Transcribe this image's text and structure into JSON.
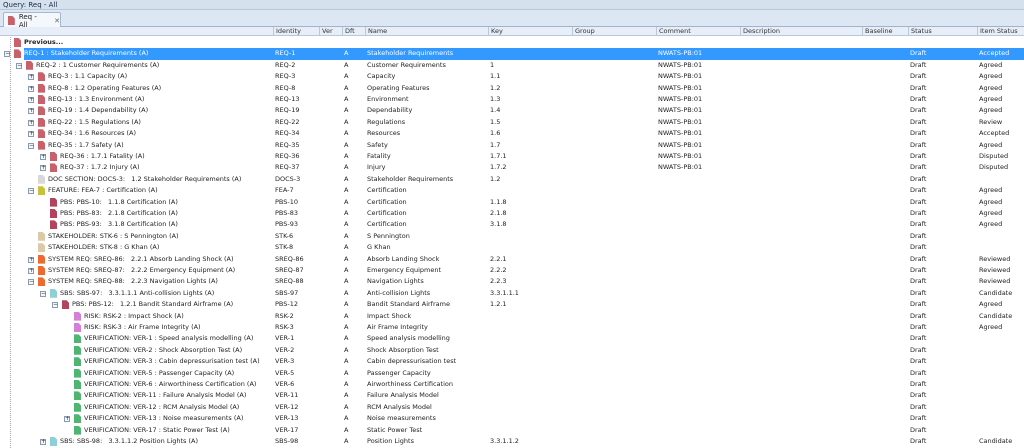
{
  "window": {
    "title": "Query: Req - All"
  },
  "tab": {
    "label": "Req - All",
    "close": "✕"
  },
  "columns": [
    "Identity",
    "Ver",
    "Dft",
    "Name",
    "Key",
    "Group",
    "Comment",
    "Description",
    "Baseline",
    "Status",
    "Item Status"
  ],
  "icon_colors": {
    "req": "#c9616a",
    "doc": "#d8d8d8",
    "fea": "#c8c23a",
    "pbs": "#b2445e",
    "stk": "#dcc9a6",
    "sreq": "#ee6a2e",
    "sbs": "#8fd0d8",
    "risk": "#d57fd6",
    "ver": "#4fb672"
  },
  "accent": "#3399ff",
  "rows": [
    {
      "label": "Previous...",
      "level": 0,
      "icon": "req",
      "exp": "",
      "identity": "",
      "ver": "",
      "dft": "",
      "name": "",
      "key": "",
      "comment": "",
      "status": "",
      "item_status": ""
    },
    {
      "label": "REQ-1 : Stakeholder Requirements (A)",
      "level": 0,
      "icon": "req",
      "exp": "-",
      "identity": "REQ-1",
      "ver": "",
      "dft": "A",
      "name": "Stakeholder Requirements",
      "key": "",
      "comment": "NWATS-PB:01",
      "status": "Draft",
      "item_status": "Accepted",
      "selected": true
    },
    {
      "label": "REQ-2 : 1 Customer Requirements (A)",
      "level": 1,
      "icon": "req",
      "exp": "-",
      "identity": "REQ-2",
      "ver": "",
      "dft": "A",
      "name": "Customer Requirements",
      "key": "1",
      "comment": "NWATS-PB:01",
      "status": "Draft",
      "item_status": "Agreed"
    },
    {
      "label": "REQ-3 : 1.1 Capacity (A)",
      "level": 2,
      "icon": "req",
      "exp": "+",
      "identity": "REQ-3",
      "ver": "",
      "dft": "A",
      "name": "Capacity",
      "key": "1.1",
      "comment": "NWATS-PB:01",
      "status": "Draft",
      "item_status": "Agreed"
    },
    {
      "label": "REQ-8 : 1.2 Operating Features (A)",
      "level": 2,
      "icon": "req",
      "exp": "+",
      "identity": "REQ-8",
      "ver": "",
      "dft": "A",
      "name": "Operating Features",
      "key": "1.2",
      "comment": "NWATS-PB:01",
      "status": "Draft",
      "item_status": "Agreed"
    },
    {
      "label": "REQ-13 : 1.3 Environment (A)",
      "level": 2,
      "icon": "req",
      "exp": "+",
      "identity": "REQ-13",
      "ver": "",
      "dft": "A",
      "name": "Environment",
      "key": "1.3",
      "comment": "NWATS-PB:01",
      "status": "Draft",
      "item_status": "Agreed"
    },
    {
      "label": "REQ-19 : 1.4 Dependability (A)",
      "level": 2,
      "icon": "req",
      "exp": "+",
      "identity": "REQ-19",
      "ver": "",
      "dft": "A",
      "name": "Dependability",
      "key": "1.4",
      "comment": "NWATS-PB:01",
      "status": "Draft",
      "item_status": "Agreed"
    },
    {
      "label": "REQ-22 : 1.5 Regulations (A)",
      "level": 2,
      "icon": "req",
      "exp": "+",
      "identity": "REQ-22",
      "ver": "",
      "dft": "A",
      "name": "Regulations",
      "key": "1.5",
      "comment": "NWATS-PB:01",
      "status": "Draft",
      "item_status": "Review"
    },
    {
      "label": "REQ-34 : 1.6 Resources (A)",
      "level": 2,
      "icon": "req",
      "exp": "+",
      "identity": "REQ-34",
      "ver": "",
      "dft": "A",
      "name": "Resources",
      "key": "1.6",
      "comment": "NWATS-PB:01",
      "status": "Draft",
      "item_status": "Accepted"
    },
    {
      "label": "REQ-35 : 1.7 Safety (A)",
      "level": 2,
      "icon": "req",
      "exp": "-",
      "identity": "REQ-35",
      "ver": "",
      "dft": "A",
      "name": "Safety",
      "key": "1.7",
      "comment": "NWATS-PB:01",
      "status": "Draft",
      "item_status": "Agreed"
    },
    {
      "label": "REQ-36 : 1.7.1 Fatality (A)",
      "level": 3,
      "icon": "req",
      "exp": "+",
      "identity": "REQ-36",
      "ver": "",
      "dft": "A",
      "name": "Fatality",
      "key": "1.7.1",
      "comment": "NWATS-PB:01",
      "status": "Draft",
      "item_status": "Disputed"
    },
    {
      "label": "REQ-37 : 1.7.2 Injury (A)",
      "level": 3,
      "icon": "req",
      "exp": "+",
      "identity": "REQ-37",
      "ver": "",
      "dft": "A",
      "name": "Injury",
      "key": "1.7.2",
      "comment": "NWATS-PB:01",
      "status": "Draft",
      "item_status": "Disputed"
    },
    {
      "label": "DOC SECTION: DOCS-3:   1.2 Stakeholder Requirements (A)",
      "level": 2,
      "icon": "doc",
      "exp": "",
      "identity": "DOCS-3",
      "ver": "",
      "dft": "A",
      "name": "Stakeholder Requirements",
      "key": "1.2",
      "comment": "",
      "status": "Draft",
      "item_status": ""
    },
    {
      "label": "FEATURE: FEA-7 : Certification (A)",
      "level": 2,
      "icon": "fea",
      "exp": "-",
      "identity": "FEA-7",
      "ver": "",
      "dft": "A",
      "name": "Certification",
      "key": "",
      "comment": "",
      "status": "Draft",
      "item_status": "Agreed"
    },
    {
      "label": "PBS: PBS-10:   1.1.8 Certification (A)",
      "level": 3,
      "icon": "pbs",
      "exp": "",
      "identity": "PBS-10",
      "ver": "",
      "dft": "A",
      "name": "Certification",
      "key": "1.1.8",
      "comment": "",
      "status": "Draft",
      "item_status": "Agreed"
    },
    {
      "label": "PBS: PBS-83:   2.1.8 Certification (A)",
      "level": 3,
      "icon": "pbs",
      "exp": "",
      "identity": "PBS-83",
      "ver": "",
      "dft": "A",
      "name": "Certification",
      "key": "2.1.8",
      "comment": "",
      "status": "Draft",
      "item_status": "Agreed"
    },
    {
      "label": "PBS: PBS-93:   3.1.8 Certification (A)",
      "level": 3,
      "icon": "pbs",
      "exp": "",
      "identity": "PBS-93",
      "ver": "",
      "dft": "A",
      "name": "Certification",
      "key": "3.1.8",
      "comment": "",
      "status": "Draft",
      "item_status": "Agreed"
    },
    {
      "label": "STAKEHOLDER: STK-6 : S Pennington (A)",
      "level": 2,
      "icon": "stk",
      "exp": "",
      "identity": "STK-6",
      "ver": "",
      "dft": "A",
      "name": "S Pennington",
      "key": "",
      "comment": "",
      "status": "Draft",
      "item_status": ""
    },
    {
      "label": "STAKEHOLDER: STK-8 : G Khan (A)",
      "level": 2,
      "icon": "stk",
      "exp": "",
      "identity": "STK-8",
      "ver": "",
      "dft": "A",
      "name": "G Khan",
      "key": "",
      "comment": "",
      "status": "Draft",
      "item_status": ""
    },
    {
      "label": "SYSTEM REQ: SREQ-86:   2.2.1 Absorb Landing Shock (A)",
      "level": 2,
      "icon": "sreq",
      "exp": "+",
      "identity": "SREQ-86",
      "ver": "",
      "dft": "A",
      "name": "Absorb Landing Shock",
      "key": "2.2.1",
      "comment": "",
      "status": "Draft",
      "item_status": "Reviewed"
    },
    {
      "label": "SYSTEM REQ: SREQ-87:   2.2.2 Emergency Equipment (A)",
      "level": 2,
      "icon": "sreq",
      "exp": "+",
      "identity": "SREQ-87",
      "ver": "",
      "dft": "A",
      "name": "Emergency Equipment",
      "key": "2.2.2",
      "comment": "",
      "status": "Draft",
      "item_status": "Reviewed"
    },
    {
      "label": "SYSTEM REQ: SREQ-88:   2.2.3 Navigation Lights (A)",
      "level": 2,
      "icon": "sreq",
      "exp": "-",
      "identity": "SREQ-88",
      "ver": "",
      "dft": "A",
      "name": "Navigation Lights",
      "key": "2.2.3",
      "comment": "",
      "status": "Draft",
      "item_status": "Reviewed"
    },
    {
      "label": "SBS: SBS-97:   3.3.1.1.1 Anti-collision Lights (A)",
      "level": 3,
      "icon": "sbs",
      "exp": "-",
      "identity": "SBS-97",
      "ver": "",
      "dft": "A",
      "name": "Anti-collision Lights",
      "key": "3.3.1.1.1",
      "comment": "",
      "status": "Draft",
      "item_status": "Candidate"
    },
    {
      "label": "PBS: PBS-12:   1.2.1 Bandit Standard Airframe (A)",
      "level": 4,
      "icon": "pbs",
      "exp": "-",
      "identity": "PBS-12",
      "ver": "",
      "dft": "A",
      "name": "Bandit Standard Airframe",
      "key": "1.2.1",
      "comment": "",
      "status": "Draft",
      "item_status": "Agreed"
    },
    {
      "label": "RISK: RSK-2 : Impact Shock (A)",
      "level": 5,
      "icon": "risk",
      "exp": "",
      "identity": "RSK-2",
      "ver": "",
      "dft": "A",
      "name": "Impact Shock",
      "key": "",
      "comment": "",
      "status": "Draft",
      "item_status": "Candidate"
    },
    {
      "label": "RISK: RSK-3 : Air Frame Integrity (A)",
      "level": 5,
      "icon": "risk",
      "exp": "",
      "identity": "RSK-3",
      "ver": "",
      "dft": "A",
      "name": "Air Frame Integrity",
      "key": "",
      "comment": "",
      "status": "Draft",
      "item_status": "Agreed"
    },
    {
      "label": "VERIFICATION: VER-1 : Speed analysis modelling (A)",
      "level": 5,
      "icon": "ver",
      "exp": "",
      "identity": "VER-1",
      "ver": "",
      "dft": "A",
      "name": "Speed analysis modelling",
      "key": "",
      "comment": "",
      "status": "Draft",
      "item_status": ""
    },
    {
      "label": "VERIFICATION: VER-2 : Shock Absorption Test (A)",
      "level": 5,
      "icon": "ver",
      "exp": "",
      "identity": "VER-2",
      "ver": "",
      "dft": "A",
      "name": "Shock Absorption Test",
      "key": "",
      "comment": "",
      "status": "Draft",
      "item_status": ""
    },
    {
      "label": "VERIFICATION: VER-3 : Cabin depressurisation test (A)",
      "level": 5,
      "icon": "ver",
      "exp": "",
      "identity": "VER-3",
      "ver": "",
      "dft": "A",
      "name": "Cabin depressurisation test",
      "key": "",
      "comment": "",
      "status": "Draft",
      "item_status": ""
    },
    {
      "label": "VERIFICATION: VER-5 : Passenger Capacity (A)",
      "level": 5,
      "icon": "ver",
      "exp": "",
      "identity": "VER-5",
      "ver": "",
      "dft": "A",
      "name": "Passenger Capacity",
      "key": "",
      "comment": "",
      "status": "Draft",
      "item_status": ""
    },
    {
      "label": "VERIFICATION: VER-6 : Airworthiness Certification (A)",
      "level": 5,
      "icon": "ver",
      "exp": "",
      "identity": "VER-6",
      "ver": "",
      "dft": "A",
      "name": "Airworthiness Certification",
      "key": "",
      "comment": "",
      "status": "Draft",
      "item_status": ""
    },
    {
      "label": "VERIFICATION: VER-11 : Failure Analysis Model (A)",
      "level": 5,
      "icon": "ver",
      "exp": "",
      "identity": "VER-11",
      "ver": "",
      "dft": "A",
      "name": "Failure Analysis Model",
      "key": "",
      "comment": "",
      "status": "Draft",
      "item_status": ""
    },
    {
      "label": "VERIFICATION: VER-12 : RCM Analysis Model (A)",
      "level": 5,
      "icon": "ver",
      "exp": "",
      "identity": "VER-12",
      "ver": "",
      "dft": "A",
      "name": "RCM Analysis Model",
      "key": "",
      "comment": "",
      "status": "Draft",
      "item_status": ""
    },
    {
      "label": "VERIFICATION: VER-13 : Noise measurements (A)",
      "level": 5,
      "icon": "ver",
      "exp": "+",
      "identity": "VER-13",
      "ver": "",
      "dft": "A",
      "name": "Noise measurements",
      "key": "",
      "comment": "",
      "status": "Draft",
      "item_status": ""
    },
    {
      "label": "VERIFICATION: VER-17 : Static Power Test (A)",
      "level": 5,
      "icon": "ver",
      "exp": "",
      "identity": "VER-17",
      "ver": "",
      "dft": "A",
      "name": "Static Power Test",
      "key": "",
      "comment": "",
      "status": "Draft",
      "item_status": ""
    },
    {
      "label": "SBS: SBS-98:   3.3.1.1.2 Position Lights (A)",
      "level": 3,
      "icon": "sbs",
      "exp": "+",
      "identity": "SBS-98",
      "ver": "",
      "dft": "A",
      "name": "Position Lights",
      "key": "3.3.1.1.2",
      "comment": "",
      "status": "Draft",
      "item_status": "Candidate"
    }
  ]
}
